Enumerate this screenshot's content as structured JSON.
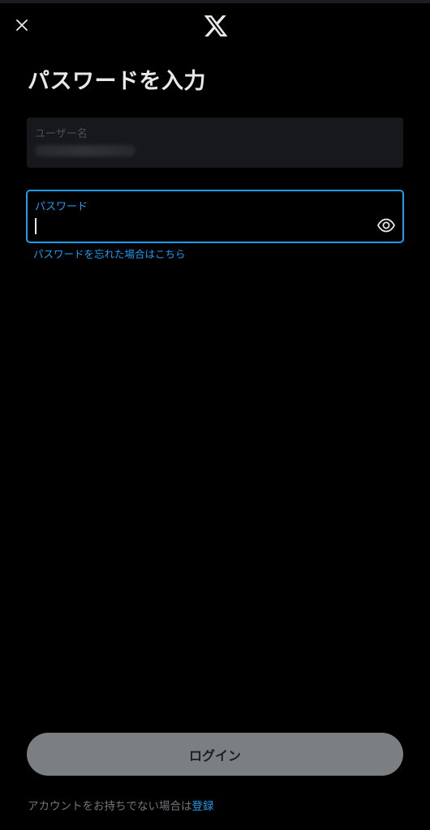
{
  "header": {
    "close_icon": "close-icon",
    "logo_icon": "x-logo-icon"
  },
  "page": {
    "title": "パスワードを入力"
  },
  "username_field": {
    "label": "ユーザー名"
  },
  "password_field": {
    "label": "パスワード",
    "value": "",
    "toggle_icon": "eye-icon"
  },
  "links": {
    "forgot_password": "パスワードを忘れた場合はこちら"
  },
  "footer": {
    "login_label": "ログイン",
    "no_account_text": "アカウントをお持ちでない場合は",
    "signup_label": "登録"
  },
  "colors": {
    "background": "#000000",
    "accent": "#1d9bf0",
    "button_disabled": "#7b7f82",
    "muted_text": "#71767b"
  }
}
